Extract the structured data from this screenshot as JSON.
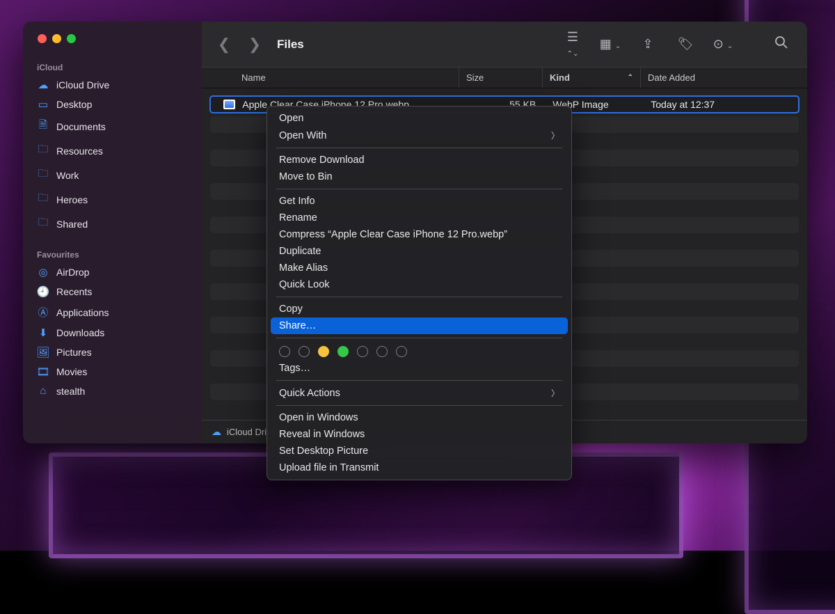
{
  "window": {
    "title": "Files"
  },
  "sidebar": {
    "sections": [
      {
        "heading": "iCloud",
        "items": [
          {
            "icon": "cloud",
            "label": "iCloud Drive"
          },
          {
            "icon": "desktop",
            "label": "Desktop"
          },
          {
            "icon": "doc",
            "label": "Documents"
          },
          {
            "icon": "folder",
            "label": "Resources"
          },
          {
            "icon": "folder",
            "label": "Work"
          },
          {
            "icon": "folder",
            "label": "Heroes"
          },
          {
            "icon": "folder-shared",
            "label": "Shared"
          }
        ]
      },
      {
        "heading": "Favourites",
        "items": [
          {
            "icon": "airdrop",
            "label": "AirDrop"
          },
          {
            "icon": "clock",
            "label": "Recents"
          },
          {
            "icon": "apps",
            "label": "Applications"
          },
          {
            "icon": "download",
            "label": "Downloads"
          },
          {
            "icon": "pictures",
            "label": "Pictures"
          },
          {
            "icon": "movies",
            "label": "Movies"
          },
          {
            "icon": "home",
            "label": "stealth"
          }
        ]
      }
    ]
  },
  "columns": {
    "name": "Name",
    "size": "Size",
    "kind": "Kind",
    "date": "Date Added"
  },
  "files": [
    {
      "name": "Apple Clear Case iPhone 12 Pro.webp",
      "size": "55 KB",
      "kind": "WebP Image",
      "date": "Today at 12:37",
      "selected": true
    }
  ],
  "statusbar": {
    "icon_label": "iCloud Drive",
    "remaining": "iCloud"
  },
  "context_menu": {
    "groups": [
      [
        {
          "label": "Open"
        },
        {
          "label": "Open With",
          "submenu": true
        }
      ],
      [
        {
          "label": "Remove Download"
        },
        {
          "label": "Move to Bin"
        }
      ],
      [
        {
          "label": "Get Info"
        },
        {
          "label": "Rename"
        },
        {
          "label": "Compress “Apple Clear Case iPhone 12 Pro.webp”"
        },
        {
          "label": "Duplicate"
        },
        {
          "label": "Make Alias"
        },
        {
          "label": "Quick Look"
        }
      ],
      [
        {
          "label": "Copy"
        },
        {
          "label": "Share…",
          "highlight": true
        }
      ],
      [
        {
          "tags": true
        },
        {
          "label": "Tags…"
        }
      ],
      [
        {
          "label": "Quick Actions",
          "submenu": true
        }
      ],
      [
        {
          "label": "Open in Windows"
        },
        {
          "label": "Reveal in Windows"
        },
        {
          "label": "Set Desktop Picture"
        },
        {
          "label": "Upload file in Transmit"
        }
      ]
    ]
  }
}
